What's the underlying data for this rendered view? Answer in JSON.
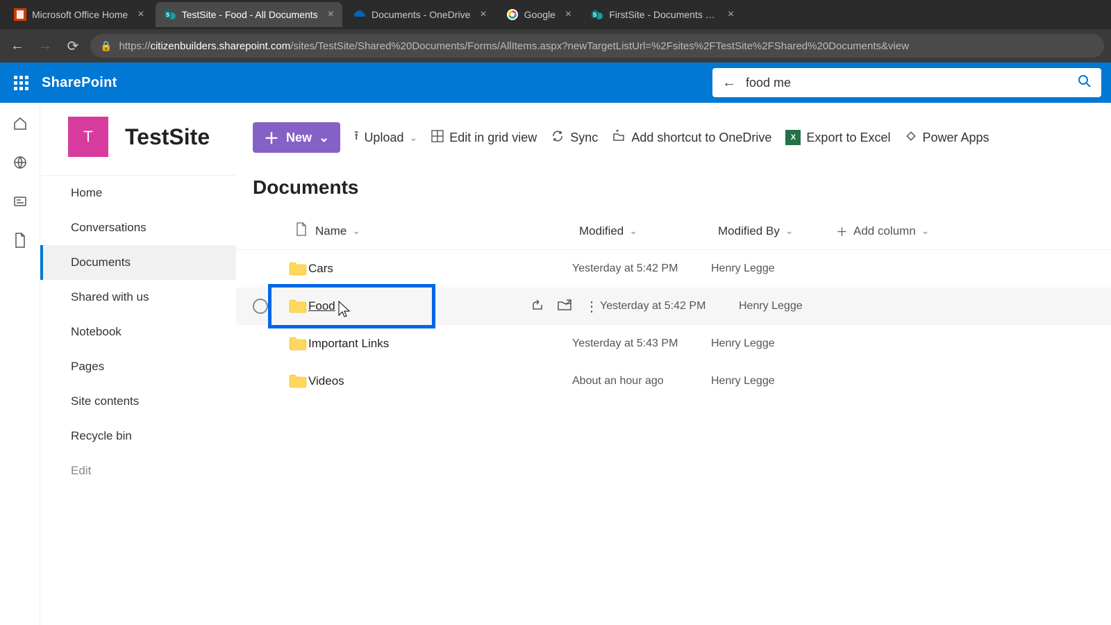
{
  "browser": {
    "tabs": [
      {
        "title": "Microsoft Office Home",
        "active": false,
        "favicon": "office"
      },
      {
        "title": "TestSite - Food - All Documents",
        "active": true,
        "favicon": "sp"
      },
      {
        "title": "Documents - OneDrive",
        "active": false,
        "favicon": "od"
      },
      {
        "title": "Google",
        "active": false,
        "favicon": "g"
      },
      {
        "title": "FirstSite - Documents - All Docu",
        "active": false,
        "favicon": "sp"
      }
    ],
    "url": {
      "domain": "citizenbuilders.sharepoint.com",
      "path": "/sites/TestSite/Shared%20Documents/Forms/AllItems.aspx?newTargetListUrl=%2Fsites%2FTestSite%2FShared%20Documents&view"
    }
  },
  "suite": {
    "app": "SharePoint",
    "search_value": "food me"
  },
  "site": {
    "logo_letter": "T",
    "name": "TestSite"
  },
  "nav": {
    "items": [
      "Home",
      "Conversations",
      "Documents",
      "Shared with us",
      "Notebook",
      "Pages",
      "Site contents",
      "Recycle bin",
      "Edit"
    ],
    "selected_index": 2
  },
  "commands": {
    "new": "New",
    "upload": "Upload",
    "edit_grid": "Edit in grid view",
    "sync": "Sync",
    "shortcut": "Add shortcut to OneDrive",
    "export": "Export to Excel",
    "power_apps": "Power Apps"
  },
  "library": {
    "title": "Documents",
    "columns": {
      "name": "Name",
      "modified": "Modified",
      "modified_by": "Modified By",
      "add": "Add column"
    },
    "rows": [
      {
        "name": "Cars",
        "modified": "Yesterday at 5:42 PM",
        "modified_by": "Henry Legge"
      },
      {
        "name": "Food",
        "modified": "Yesterday at 5:42 PM",
        "modified_by": "Henry Legge"
      },
      {
        "name": "Important Links",
        "modified": "Yesterday at 5:43 PM",
        "modified_by": "Henry Legge"
      },
      {
        "name": "Videos",
        "modified": "About an hour ago",
        "modified_by": "Henry Legge"
      }
    ],
    "hovered_row_index": 1
  }
}
